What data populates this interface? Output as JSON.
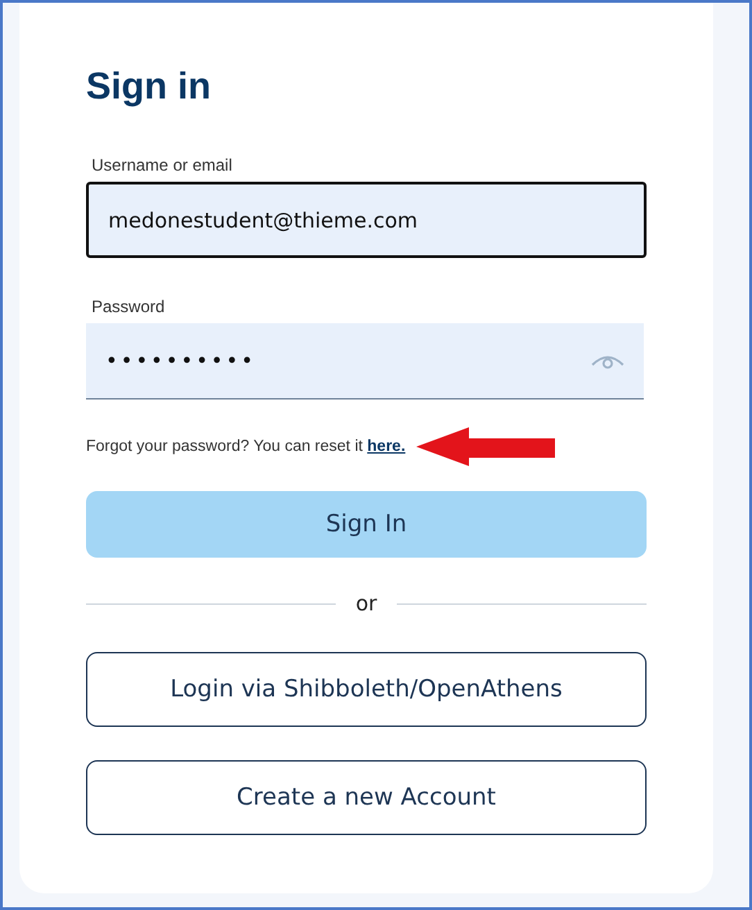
{
  "title": "Sign in",
  "fields": [
    {
      "label": "Username or email",
      "value": "medonestudent@thieme.com",
      "kind": "text",
      "focused": true
    },
    {
      "label": "Password",
      "value": "••••••••••",
      "kind": "password",
      "focused": false
    }
  ],
  "forgot": {
    "text": "Forgot your password? You can reset it",
    "link": "here."
  },
  "primary_button": "Sign In",
  "divider": "or",
  "buttons": [
    "Login via Shibboleth/OpenAthens",
    "Create a new Account"
  ]
}
